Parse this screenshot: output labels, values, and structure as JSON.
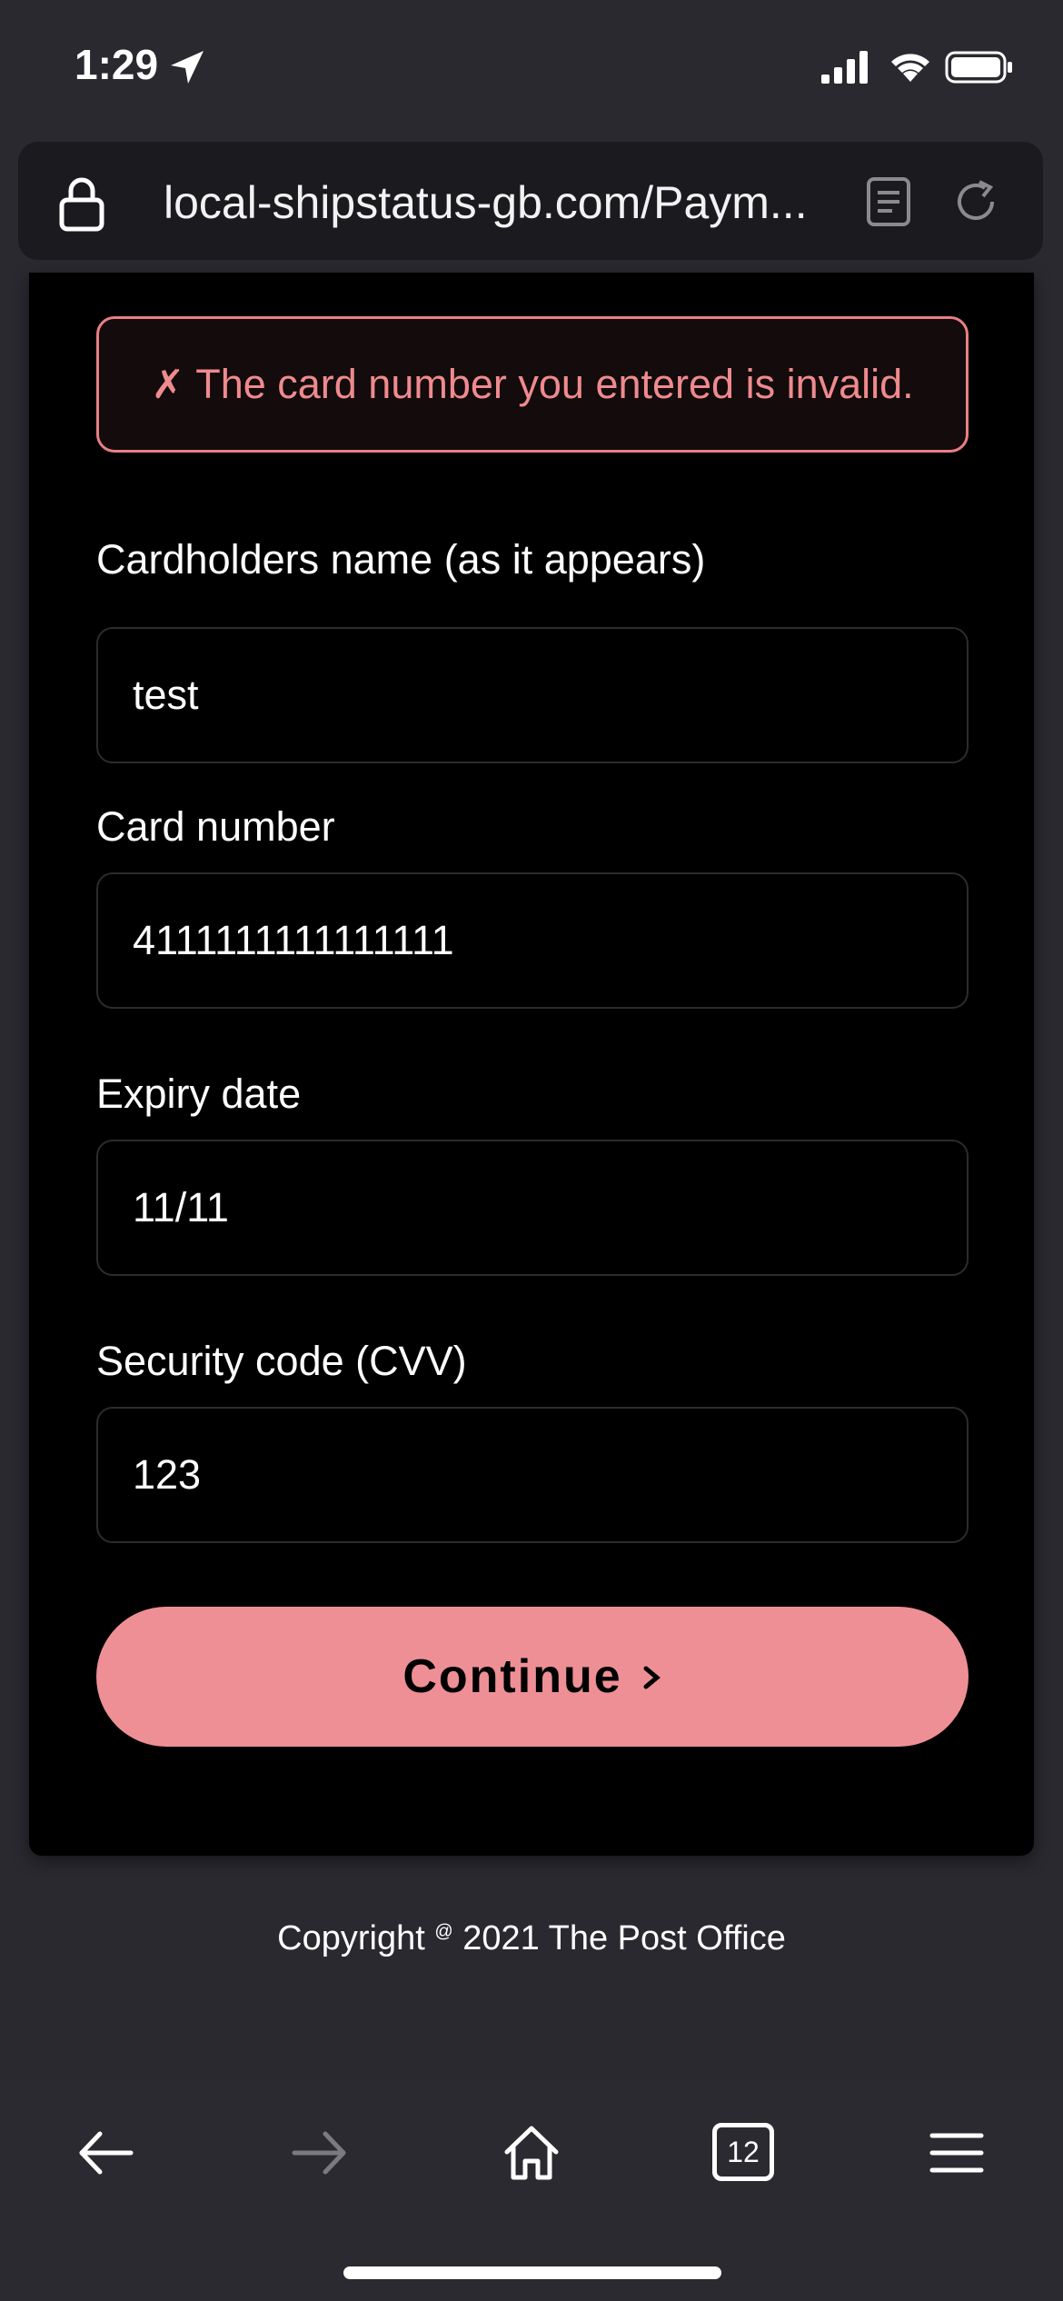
{
  "status_bar": {
    "time": "1:29",
    "icons": [
      "location-arrow-icon",
      "cellular-signal-icon",
      "wifi-icon",
      "battery-icon"
    ]
  },
  "browser": {
    "url": "local-shipstatus-gb.com/Paym...",
    "icons": [
      "lock-icon",
      "reader-mode-icon",
      "reload-icon"
    ]
  },
  "error": {
    "mark": "✗",
    "message": "The card number you entered is invalid."
  },
  "form": {
    "cardholder_label": "Cardholders name (as it appears)",
    "cardholder_value": "test",
    "card_number_label": "Card number",
    "card_number_value": "4111111111111111",
    "expiry_label": "Expiry date",
    "expiry_value": "11/11",
    "cvv_label": "Security code (CVV)",
    "cvv_value": "123",
    "continue_label": "Continue"
  },
  "footer": {
    "copyright_prefix": "Copyright",
    "copyright_symbol": "@",
    "copyright_suffix": "2021 The Post Office"
  },
  "toolbar": {
    "tab_count": "12",
    "icons": [
      "back-arrow-icon",
      "forward-arrow-icon",
      "home-icon",
      "tabs-icon",
      "menu-icon"
    ]
  },
  "colors": {
    "accent": "#ee8f96",
    "error_text": "#ef8a8e",
    "background": "#2a2930",
    "card": "#000000"
  }
}
